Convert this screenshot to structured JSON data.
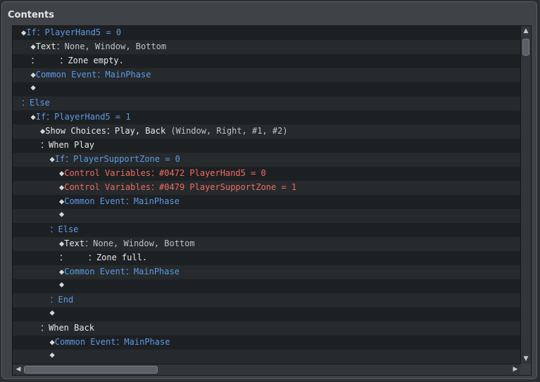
{
  "panel": {
    "title": "Contents"
  },
  "colors": {
    "white": "#e8e8e8",
    "gray": "#c0c4c8",
    "blue": "#5d9ae6",
    "red": "#ef6b63"
  },
  "rows": [
    {
      "indent": 0,
      "segs": [
        {
          "t": "◆",
          "c": "diamond"
        },
        {
          "t": "If：PlayerHand5 = 0",
          "c": "blue"
        }
      ]
    },
    {
      "indent": 1,
      "segs": [
        {
          "t": "◆",
          "c": "diamond"
        },
        {
          "t": "Text",
          "c": "white"
        },
        {
          "t": "：None, Window, Bottom",
          "c": "gray"
        }
      ]
    },
    {
      "indent": 1,
      "segs": [
        {
          "t": "：    ：Zone empty.",
          "c": "white"
        }
      ]
    },
    {
      "indent": 1,
      "segs": [
        {
          "t": "◆",
          "c": "diamond"
        },
        {
          "t": "Common Event：MainPhase",
          "c": "blue"
        }
      ]
    },
    {
      "indent": 1,
      "segs": [
        {
          "t": "◆",
          "c": "diamond"
        }
      ]
    },
    {
      "indent": 0,
      "segs": [
        {
          "t": "：Else",
          "c": "blue"
        }
      ]
    },
    {
      "indent": 1,
      "segs": [
        {
          "t": "◆",
          "c": "diamond"
        },
        {
          "t": "If：PlayerHand5 = 1",
          "c": "blue"
        }
      ]
    },
    {
      "indent": 2,
      "segs": [
        {
          "t": "◆",
          "c": "diamond"
        },
        {
          "t": "Show Choices：Play, Back",
          "c": "white"
        },
        {
          "t": " (Window, Right, #1, #2)",
          "c": "gray"
        }
      ]
    },
    {
      "indent": 2,
      "segs": [
        {
          "t": "：When Play",
          "c": "white"
        }
      ]
    },
    {
      "indent": 3,
      "segs": [
        {
          "t": "◆",
          "c": "diamond"
        },
        {
          "t": "If：PlayerSupportZone = 0",
          "c": "blue"
        }
      ]
    },
    {
      "indent": 4,
      "segs": [
        {
          "t": "◆",
          "c": "diamond"
        },
        {
          "t": "Control Variables：#0472 PlayerHand5 = 0",
          "c": "red"
        }
      ]
    },
    {
      "indent": 4,
      "segs": [
        {
          "t": "◆",
          "c": "diamond"
        },
        {
          "t": "Control Variables：#0479 PlayerSupportZone = 1",
          "c": "red"
        }
      ]
    },
    {
      "indent": 4,
      "segs": [
        {
          "t": "◆",
          "c": "diamond"
        },
        {
          "t": "Common Event：MainPhase",
          "c": "blue"
        }
      ]
    },
    {
      "indent": 4,
      "segs": [
        {
          "t": "◆",
          "c": "diamond"
        }
      ]
    },
    {
      "indent": 3,
      "segs": [
        {
          "t": "：Else",
          "c": "blue"
        }
      ]
    },
    {
      "indent": 4,
      "segs": [
        {
          "t": "◆",
          "c": "diamond"
        },
        {
          "t": "Text",
          "c": "white"
        },
        {
          "t": "：None, Window, Bottom",
          "c": "gray"
        }
      ]
    },
    {
      "indent": 4,
      "segs": [
        {
          "t": "：    ：Zone full.",
          "c": "white"
        }
      ]
    },
    {
      "indent": 4,
      "segs": [
        {
          "t": "◆",
          "c": "diamond"
        },
        {
          "t": "Common Event：MainPhase",
          "c": "blue"
        }
      ]
    },
    {
      "indent": 4,
      "segs": [
        {
          "t": "◆",
          "c": "diamond"
        }
      ]
    },
    {
      "indent": 3,
      "segs": [
        {
          "t": "：End",
          "c": "blue"
        }
      ]
    },
    {
      "indent": 3,
      "segs": [
        {
          "t": "◆",
          "c": "diamond"
        }
      ]
    },
    {
      "indent": 2,
      "segs": [
        {
          "t": "：When Back",
          "c": "white"
        }
      ]
    },
    {
      "indent": 3,
      "segs": [
        {
          "t": "◆",
          "c": "diamond"
        },
        {
          "t": "Common Event：MainPhase",
          "c": "blue"
        }
      ]
    },
    {
      "indent": 3,
      "segs": [
        {
          "t": "◆",
          "c": "diamond"
        }
      ]
    }
  ],
  "scrollbars": {
    "up_icon": "arrow-up-icon",
    "down_icon": "arrow-down-icon",
    "left_icon": "arrow-left-icon",
    "right_icon": "arrow-right-icon"
  }
}
